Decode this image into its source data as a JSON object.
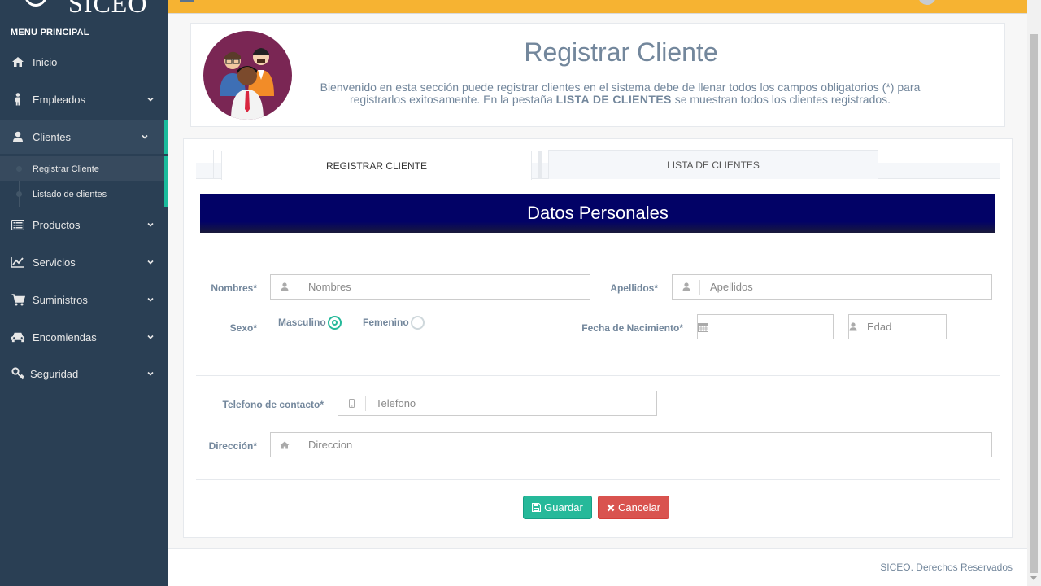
{
  "sidebar": {
    "logo": "SICEO",
    "menu_title": "MENU PRINCIPAL",
    "items": [
      {
        "label": "Inicio",
        "icon": "home-icon"
      },
      {
        "label": "Empleados",
        "icon": "person-icon"
      },
      {
        "label": "Clientes",
        "icon": "user-icon"
      },
      {
        "label": "Productos",
        "icon": "list-icon"
      },
      {
        "label": "Servicios",
        "icon": "line-chart-icon"
      },
      {
        "label": "Suministros",
        "icon": "cart-icon"
      },
      {
        "label": "Encomiendas",
        "icon": "car-icon"
      },
      {
        "label": "Seguridad",
        "icon": "key-icon"
      }
    ],
    "submenu": [
      {
        "label": "Registrar Cliente"
      },
      {
        "label": "Listado de clientes"
      }
    ]
  },
  "header": {
    "title": "Registrar Cliente",
    "intro_part1": "Bienvenido en esta sección puede registrar clientes en el sistema debe de llenar todos los campos obligatorios (*) para registrarlos exitosamente. En la pestaña",
    "intro_bold": "LISTA DE CLIENTES",
    "intro_part2": "se muestran todos los clientes registrados."
  },
  "tabs": [
    {
      "label": "REGISTRAR CLIENTE"
    },
    {
      "label": "LISTA DE CLIENTES"
    }
  ],
  "section_title": "Datos Personales",
  "form": {
    "nombres_label": "Nombres*",
    "nombres_placeholder": "Nombres",
    "apellidos_label": "Apellidos*",
    "apellidos_placeholder": "Apellidos",
    "sexo_label": "Sexo*",
    "masculino_label": "Masculino",
    "femenino_label": "Femenino",
    "fecha_label": "Fecha de Nacimiento*",
    "fecha_placeholder": "",
    "edad_placeholder": "Edad",
    "telefono_label": "Telefono de contacto*",
    "telefono_placeholder": "Telefono",
    "direccion_label": "Dirección*",
    "direccion_placeholder": "Direccion",
    "sexo_selected": "Masculino"
  },
  "buttons": {
    "save": "Guardar",
    "cancel": "Cancelar"
  },
  "footer": "SICEO. Derechos Reservados",
  "colors": {
    "sidebar": "#2a3f54",
    "topbar": "#f6b332",
    "accent": "#1abb9c",
    "banner": "#020266",
    "save": "#26b99a",
    "cancel": "#d9534f"
  }
}
